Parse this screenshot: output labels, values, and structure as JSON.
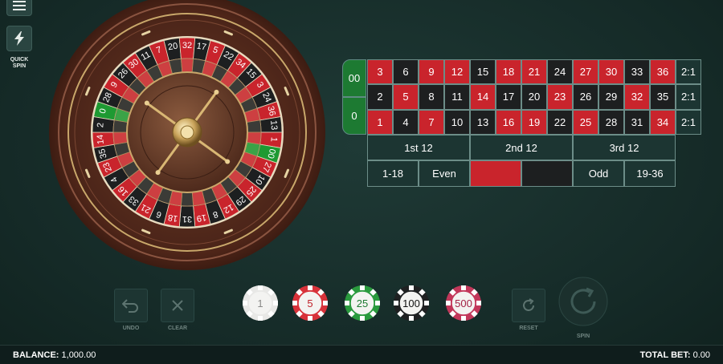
{
  "sidebar": {
    "quick_spin_line1": "QUICK",
    "quick_spin_line2": "SPIN"
  },
  "wheel": {
    "sequence": [
      "0",
      "28",
      "9",
      "26",
      "30",
      "11",
      "7",
      "20",
      "32",
      "17",
      "5",
      "22",
      "34",
      "15",
      "3",
      "24",
      "36",
      "13",
      "1",
      "00",
      "27",
      "10",
      "25",
      "29",
      "12",
      "8",
      "19",
      "31",
      "18",
      "6",
      "21",
      "33",
      "16",
      "4",
      "23",
      "35",
      "14",
      "2"
    ],
    "red_numbers": [
      1,
      3,
      5,
      7,
      9,
      12,
      14,
      16,
      18,
      19,
      21,
      23,
      25,
      27,
      30,
      32,
      34,
      36
    ],
    "colors": {
      "red": "#c9242c",
      "black": "#1d1f20",
      "green": "#1e9a32",
      "wood": "#5e2e1f",
      "gold": "#c9a76a"
    }
  },
  "table": {
    "zero_top": "00",
    "zero_bottom": "0",
    "rows": [
      [
        "3",
        "6",
        "9",
        "12",
        "15",
        "18",
        "21",
        "24",
        "27",
        "30",
        "33",
        "36"
      ],
      [
        "2",
        "5",
        "8",
        "11",
        "14",
        "17",
        "20",
        "23",
        "26",
        "29",
        "32",
        "35"
      ],
      [
        "1",
        "4",
        "7",
        "10",
        "13",
        "16",
        "19",
        "22",
        "25",
        "28",
        "31",
        "34"
      ]
    ],
    "column_bets": [
      "2:1",
      "2:1",
      "2:1"
    ],
    "dozens": [
      "1st 12",
      "2nd 12",
      "3rd 12"
    ],
    "outside": {
      "low": "1-18",
      "even": "Even",
      "odd": "Odd",
      "high": "19-36"
    }
  },
  "controls": {
    "undo": "UNDO",
    "clear": "CLEAR",
    "reset": "RESET",
    "spin": "SPIN"
  },
  "chips": [
    {
      "value": "1",
      "color": "#e8e8e6",
      "text_color": "#8a8a88"
    },
    {
      "value": "5",
      "color": "#d8323a",
      "text_color": "#c0222a"
    },
    {
      "value": "25",
      "color": "#2a9a3e",
      "text_color": "#1d7a32"
    },
    {
      "value": "100",
      "color": "#1f2122",
      "text_color": "#111111"
    },
    {
      "value": "500",
      "color": "#c2375a",
      "text_color": "#a22245"
    }
  ],
  "footer": {
    "balance_label": "BALANCE:",
    "balance_value": "1,000.00",
    "total_bet_label": "TOTAL BET:",
    "total_bet_value": "0.00"
  }
}
